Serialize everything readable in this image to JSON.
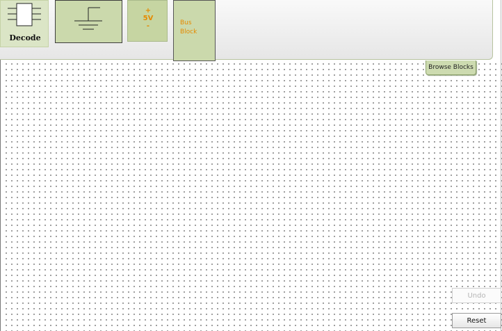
{
  "palette": {
    "blocks": [
      {
        "label": "Decode",
        "icon": "ic-chip-icon"
      },
      {
        "icon": "ground-symbol-icon"
      },
      {
        "plus": "+",
        "voltage": "5V",
        "minus": "-",
        "icon": "power-5v-icon"
      },
      {
        "label": "Bus\nBlock"
      }
    ],
    "browse_label": "Browse Blocks"
  },
  "controls": {
    "undo_label": "Undo",
    "reset_label": "Reset"
  },
  "colors": {
    "block_green": "#cbd9ac",
    "accent_orange": "#e58a00",
    "dot_grey": "#8c8c8c"
  }
}
